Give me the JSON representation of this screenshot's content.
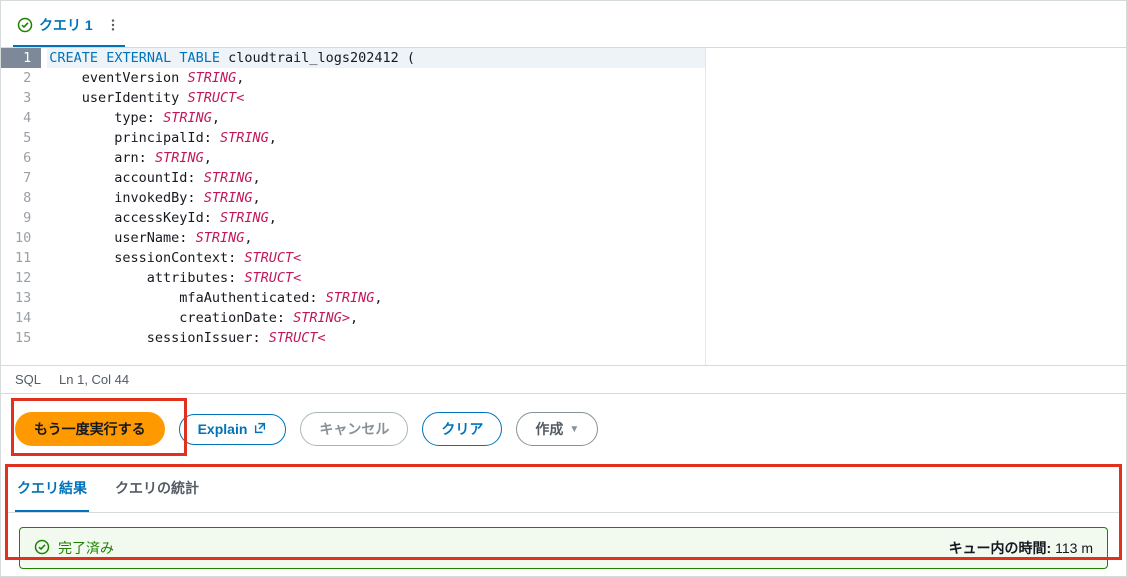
{
  "tab": {
    "label": "クエリ 1"
  },
  "editor": {
    "lines": [
      {
        "n": 1,
        "current": true,
        "tokens": [
          [
            "kw",
            "CREATE"
          ],
          [
            "plain",
            " "
          ],
          [
            "kw",
            "EXTERNAL"
          ],
          [
            "plain",
            " "
          ],
          [
            "kw",
            "TABLE"
          ],
          [
            "plain",
            " cloudtrail_logs202412 ("
          ]
        ]
      },
      {
        "n": 2,
        "tokens": [
          [
            "plain",
            "    eventVersion "
          ],
          [
            "type",
            "STRING"
          ],
          [
            "plain",
            ","
          ]
        ]
      },
      {
        "n": 3,
        "tokens": [
          [
            "plain",
            "    userIdentity "
          ],
          [
            "type",
            "STRUCT<"
          ]
        ]
      },
      {
        "n": 4,
        "tokens": [
          [
            "plain",
            "        type: "
          ],
          [
            "type",
            "STRING"
          ],
          [
            "plain",
            ","
          ]
        ]
      },
      {
        "n": 5,
        "tokens": [
          [
            "plain",
            "        principalId: "
          ],
          [
            "type",
            "STRING"
          ],
          [
            "plain",
            ","
          ]
        ]
      },
      {
        "n": 6,
        "tokens": [
          [
            "plain",
            "        arn: "
          ],
          [
            "type",
            "STRING"
          ],
          [
            "plain",
            ","
          ]
        ]
      },
      {
        "n": 7,
        "tokens": [
          [
            "plain",
            "        accountId: "
          ],
          [
            "type",
            "STRING"
          ],
          [
            "plain",
            ","
          ]
        ]
      },
      {
        "n": 8,
        "tokens": [
          [
            "plain",
            "        invokedBy: "
          ],
          [
            "type",
            "STRING"
          ],
          [
            "plain",
            ","
          ]
        ]
      },
      {
        "n": 9,
        "tokens": [
          [
            "plain",
            "        accessKeyId: "
          ],
          [
            "type",
            "STRING"
          ],
          [
            "plain",
            ","
          ]
        ]
      },
      {
        "n": 10,
        "tokens": [
          [
            "plain",
            "        userName: "
          ],
          [
            "type",
            "STRING"
          ],
          [
            "plain",
            ","
          ]
        ]
      },
      {
        "n": 11,
        "tokens": [
          [
            "plain",
            "        sessionContext: "
          ],
          [
            "type",
            "STRUCT<"
          ]
        ]
      },
      {
        "n": 12,
        "tokens": [
          [
            "plain",
            "            attributes: "
          ],
          [
            "type",
            "STRUCT<"
          ]
        ]
      },
      {
        "n": 13,
        "tokens": [
          [
            "plain",
            "                mfaAuthenticated: "
          ],
          [
            "type",
            "STRING"
          ],
          [
            "plain",
            ","
          ]
        ]
      },
      {
        "n": 14,
        "tokens": [
          [
            "plain",
            "                creationDate: "
          ],
          [
            "type",
            "STRING>"
          ],
          [
            "plain",
            ","
          ]
        ]
      },
      {
        "n": 15,
        "tokens": [
          [
            "plain",
            "            sessionIssuer: "
          ],
          [
            "type",
            "STRUCT<"
          ]
        ]
      }
    ],
    "cursor_line_has_caret_after": "cloudtrail_logs202412"
  },
  "status": {
    "lang": "SQL",
    "pos": "Ln 1, Col 44"
  },
  "toolbar": {
    "run": "もう一度実行する",
    "explain": "Explain",
    "cancel": "キャンセル",
    "clear": "クリア",
    "create": "作成"
  },
  "results": {
    "tabs": {
      "results": "クエリ結果",
      "stats": "クエリの統計"
    },
    "completed": "完了済み",
    "queue_label": "キュー内の時間:",
    "queue_value": "113 m"
  }
}
